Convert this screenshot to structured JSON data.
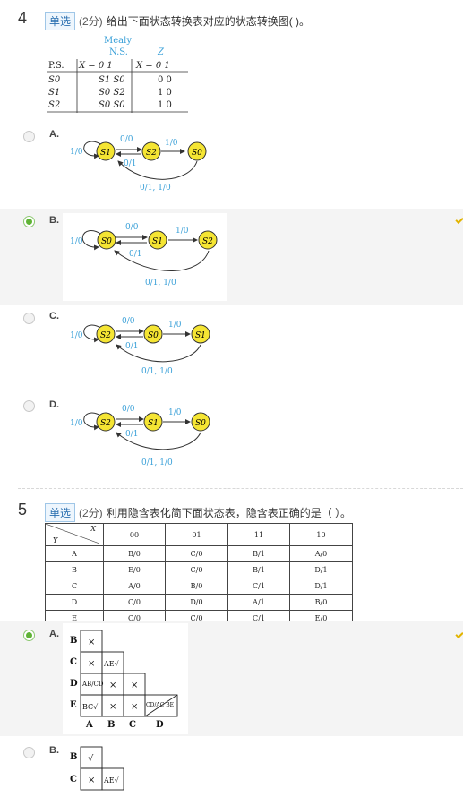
{
  "q4": {
    "number": "4",
    "type": "单选",
    "points": "(2分)",
    "text": "给出下面状态转换表对应的状态转换图(   )。",
    "table": {
      "h_mealy": "Mealy",
      "h_ns": "N.S.",
      "h_z": "Z",
      "h_ps": "P.S.",
      "h_x": "X = 0   1",
      "rows": [
        {
          "ps": "S0",
          "ns": "S1  S0",
          "z": "0  0"
        },
        {
          "ps": "S1",
          "ns": "S0  S2",
          "z": "1  0"
        },
        {
          "ps": "S2",
          "ns": "S0  S0",
          "z": "1  0"
        }
      ]
    },
    "options": [
      {
        "label": "A.",
        "states": [
          "S1",
          "S2",
          "S0"
        ],
        "top": "0/0",
        "bottom": "0/1",
        "self": "1/0",
        "right": "1/0",
        "long": "0/1, 1/0"
      },
      {
        "label": "B.",
        "states": [
          "S0",
          "S1",
          "S2"
        ],
        "top": "0/0",
        "bottom": "0/1",
        "self": "1/0",
        "right": "1/0",
        "long": "0/1, 1/0"
      },
      {
        "label": "C.",
        "states": [
          "S2",
          "S0",
          "S1"
        ],
        "top": "0/0",
        "bottom": "0/1",
        "self": "1/0",
        "right": "1/0",
        "long": "0/1, 1/0"
      },
      {
        "label": "D.",
        "states": [
          "S2",
          "S1",
          "S0"
        ],
        "top": "0/0",
        "bottom": "0/1",
        "self": "1/0",
        "right": "1/0",
        "long": "0/1, 1/0"
      }
    ]
  },
  "q5": {
    "number": "5",
    "type": "单选",
    "points": "(2分)",
    "text": "利用隐含表化简下面状态表，隐含表正确的是（ ）。",
    "table": {
      "corner_x": "X",
      "corner_y": "Y",
      "cols": [
        "00",
        "01",
        "11",
        "10"
      ],
      "rows": [
        {
          "s": "A",
          "v": [
            "B/0",
            "C/0",
            "B/1",
            "A/0"
          ]
        },
        {
          "s": "B",
          "v": [
            "E/0",
            "C/0",
            "B/1",
            "D/1"
          ]
        },
        {
          "s": "C",
          "v": [
            "A/0",
            "B/0",
            "C/1",
            "D/1"
          ]
        },
        {
          "s": "D",
          "v": [
            "C/0",
            "D/0",
            "A/1",
            "B/0"
          ]
        },
        {
          "s": "E",
          "v": [
            "C/0",
            "C/0",
            "C/1",
            "E/0"
          ]
        }
      ]
    },
    "options": [
      {
        "label": "A.",
        "rows": [
          "B",
          "C",
          "D",
          "E"
        ],
        "cols": [
          "A",
          "B",
          "C",
          "D"
        ],
        "cells": {
          "BA": "×",
          "CA": "×",
          "CB": "AE√",
          "DA": "AB/CD",
          "DB": "×",
          "DC": "×",
          "EA": "BC√",
          "EB": "×",
          "EC": "×",
          "ED": "CD/AC BE"
        }
      },
      {
        "label": "B.",
        "rows": [
          "B",
          "C"
        ],
        "cells": {
          "BA": "√",
          "CA": "×",
          "CB": "AE√"
        }
      }
    ]
  }
}
